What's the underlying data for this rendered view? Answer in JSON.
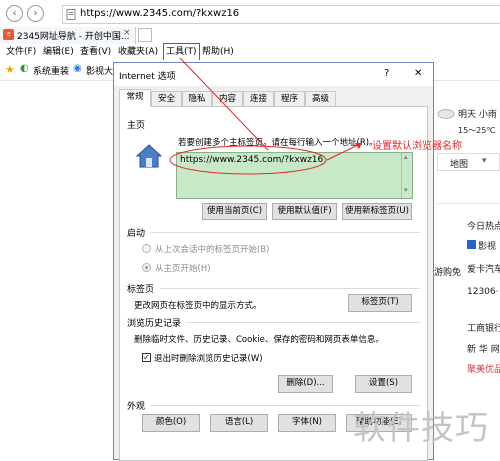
{
  "browser": {
    "address": "https://www.2345.com/?kxwz16",
    "tab_title": "2345网址导航 - 开创中国...",
    "menu": [
      "文件(F)",
      "编辑(E)",
      "查看(V)",
      "收藏夹(A)",
      "工具(T)",
      "帮助(H)"
    ],
    "favorites": [
      "系统重装",
      "影视大全"
    ]
  },
  "background_page": {
    "weather": "明天 小雨",
    "temperature": "15～25℃",
    "map_label": "地图",
    "items": [
      "今日热点",
      "影视",
      "爱卡汽车",
      "12306·",
      "工商银行",
      "新 华 网",
      "聚美优品"
    ],
    "left_item": "游购免"
  },
  "dialog": {
    "title": "Internet 选项",
    "help": "?",
    "close": "✕",
    "tabs": [
      "常规",
      "安全",
      "隐私",
      "内容",
      "连接",
      "程序",
      "高级"
    ],
    "homepage": {
      "section": "主页",
      "hint": "若要创建多个主标签页，请在每行输入一个地址(R)。",
      "url": "https://www.2345.com/?kxwz16",
      "buttons": [
        "使用当前页(C)",
        "使用默认值(F)",
        "使用新标签页(U)"
      ]
    },
    "startup": {
      "section": "启动",
      "option_last": "从上次会话中的标签页开始(B)",
      "option_home": "从主页开始(H)"
    },
    "tabs_section": {
      "section": "标签页",
      "desc": "更改网页在标签页中的显示方式。",
      "button": "标签页(T)"
    },
    "history": {
      "section": "浏览历史记录",
      "desc": "删除临时文件、历史记录、Cookie、保存的密码和网页表单信息。",
      "checkbox": "退出时删除浏览历史记录(W)",
      "delete_button": "删除(D)...",
      "settings_button": "设置(S)"
    },
    "appearance": {
      "section": "外观",
      "buttons": [
        "颜色(O)",
        "语言(L)",
        "字体(N)",
        "辅助功能(E)"
      ]
    }
  },
  "annotation": "设置默认浏览器名称",
  "watermark": "软件技巧",
  "colors": {
    "annotation_red": "#e8262a",
    "highlight_green": "#c7e9c8",
    "dialog_bg": "#f0f0f0"
  }
}
